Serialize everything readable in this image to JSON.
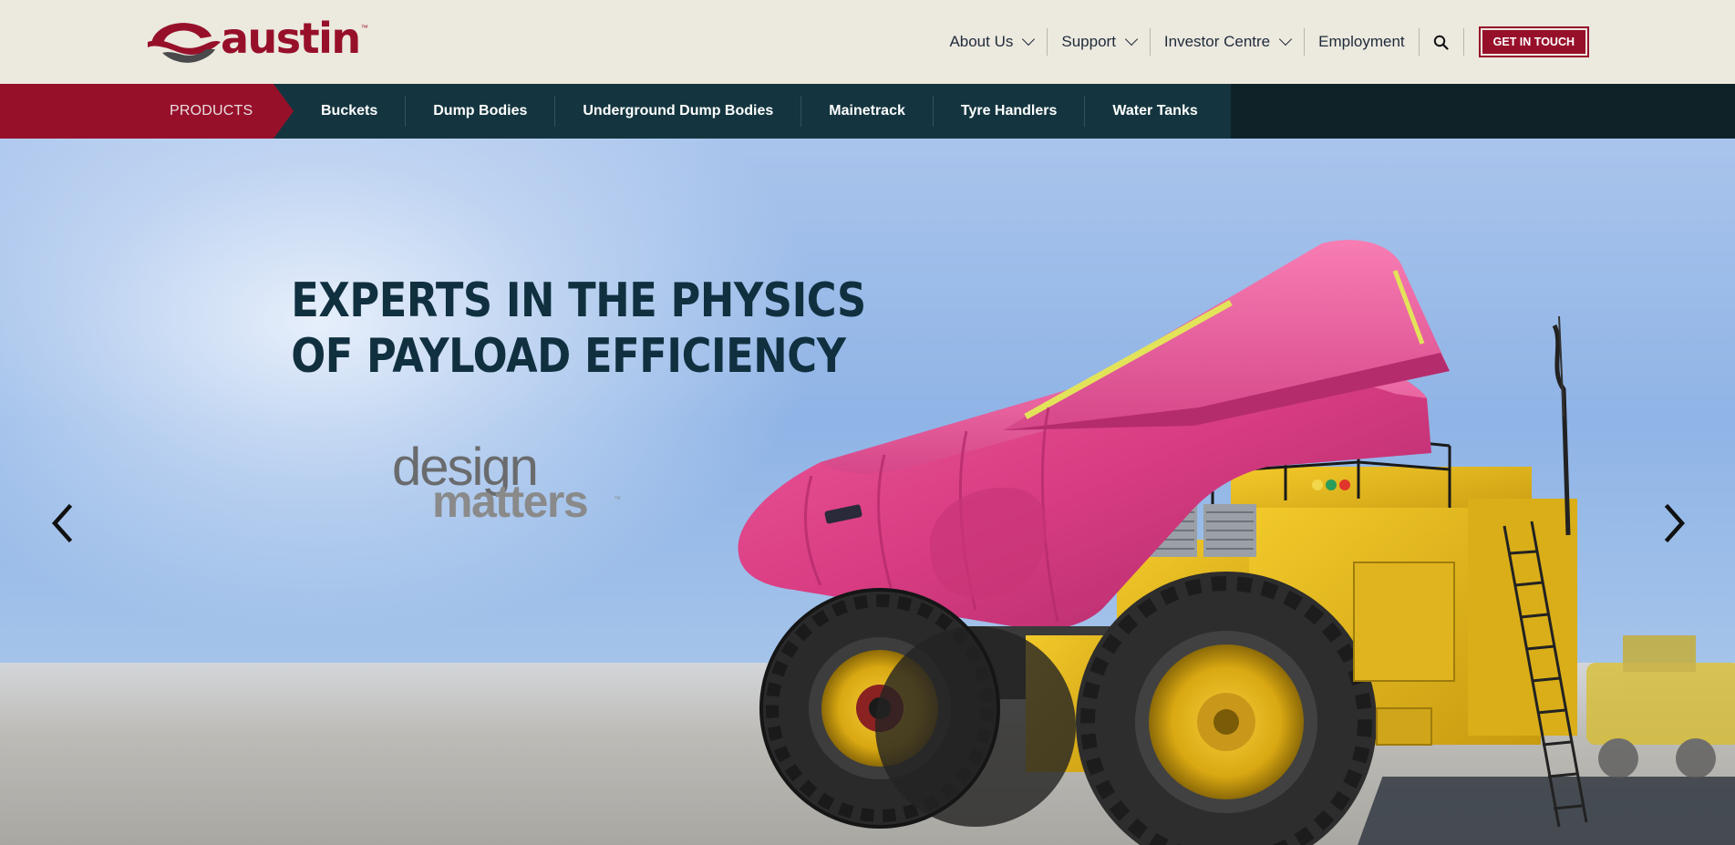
{
  "header": {
    "logo_text": "austin",
    "logo_tm": "™",
    "nav": [
      {
        "label": "About Us",
        "has_dropdown": true
      },
      {
        "label": "Support",
        "has_dropdown": true
      },
      {
        "label": "Investor Centre",
        "has_dropdown": true
      },
      {
        "label": "Employment",
        "has_dropdown": false
      }
    ],
    "search_icon": "search-icon",
    "cta_label": "GET IN TOUCH"
  },
  "products_bar": {
    "label": "PRODUCTS",
    "items": [
      {
        "label": "Buckets"
      },
      {
        "label": "Dump Bodies"
      },
      {
        "label": "Underground Dump Bodies"
      },
      {
        "label": "Mainetrack"
      },
      {
        "label": "Tyre Handlers"
      },
      {
        "label": "Water Tanks"
      }
    ]
  },
  "hero": {
    "headline": {
      "line1_bold": "EXPERTS",
      "line1_light": " IN THE PHYSICS",
      "line2_light": "OF ",
      "line2_bold": "PAYLOAD EFFICIENCY"
    },
    "tagline": {
      "word1": "design",
      "word2": "matters",
      "tm": "™"
    },
    "prev_icon": "chevron-left-icon",
    "next_icon": "chevron-right-icon"
  },
  "colors": {
    "brand_red": "#97102a",
    "nav_dark": "#0f2228",
    "nav_teal": "#14353f",
    "header_bg": "#ece9df",
    "headline": "#103040"
  }
}
